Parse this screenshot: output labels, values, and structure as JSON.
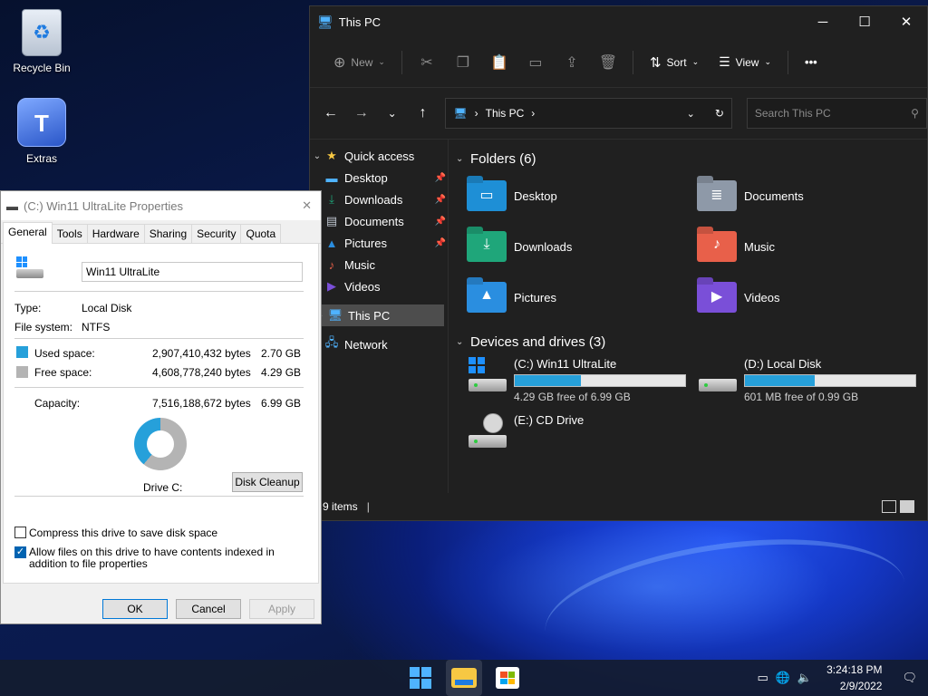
{
  "desktop": {
    "icons": [
      {
        "label": "Recycle Bin",
        "icon": "recycle-bin-icon"
      },
      {
        "label": "Extras",
        "icon": "extras-icon"
      }
    ]
  },
  "explorer": {
    "title": "This PC",
    "toolbar": {
      "new_label": "New",
      "sort_label": "Sort",
      "view_label": "View",
      "more_label": "•••"
    },
    "address": {
      "location": "This PC"
    },
    "search": {
      "placeholder": "Search This PC"
    },
    "nav": {
      "quick_access": "Quick access",
      "items": [
        {
          "label": "Desktop",
          "icon": "desktop-folder-icon"
        },
        {
          "label": "Downloads",
          "icon": "downloads-folder-icon"
        },
        {
          "label": "Documents",
          "icon": "documents-folder-icon"
        },
        {
          "label": "Pictures",
          "icon": "pictures-folder-icon"
        },
        {
          "label": "Music",
          "icon": "music-folder-icon"
        },
        {
          "label": "Videos",
          "icon": "videos-folder-icon"
        }
      ],
      "this_pc": "This PC",
      "network": "Network"
    },
    "folders": {
      "heading": "Folders (6)",
      "items": [
        {
          "label": "Desktop",
          "color": "#1e8fd6"
        },
        {
          "label": "Documents",
          "color": "#8e99a8"
        },
        {
          "label": "Downloads",
          "color": "#1fa67a"
        },
        {
          "label": "Music",
          "color": "#e8604a"
        },
        {
          "label": "Pictures",
          "color": "#2a8ee0"
        },
        {
          "label": "Videos",
          "color": "#7a4fd8"
        }
      ]
    },
    "drives": {
      "heading": "Devices and drives (3)",
      "items": [
        {
          "label": "(C:) Win11 UltraLite",
          "free": "4.29 GB free of 6.99 GB",
          "used_fraction": 0.39
        },
        {
          "label": "(D:) Local Disk",
          "free": "601 MB free of 0.99 GB",
          "used_fraction": 0.41
        },
        {
          "label": "(E:) CD Drive"
        }
      ]
    },
    "status": {
      "items": "9 items"
    }
  },
  "properties": {
    "title": "(C:) Win11 UltraLite Properties",
    "tabs": [
      "General",
      "Tools",
      "Hardware",
      "Sharing",
      "Security",
      "Quota"
    ],
    "name": "Win11 UltraLite",
    "type_label": "Type:",
    "type_value": "Local Disk",
    "fs_label": "File system:",
    "fs_value": "NTFS",
    "used_label": "Used space:",
    "used_bytes": "2,907,410,432 bytes",
    "used_gb": "2.70 GB",
    "free_label": "Free space:",
    "free_bytes": "4,608,778,240 bytes",
    "free_gb": "4.29 GB",
    "cap_label": "Capacity:",
    "cap_bytes": "7,516,188,672 bytes",
    "cap_gb": "6.99 GB",
    "drive_label": "Drive C:",
    "cleanup": "Disk Cleanup",
    "compress": "Compress this drive to save disk space",
    "index": "Allow files on this drive to have contents indexed in addition to file properties",
    "ok": "OK",
    "cancel": "Cancel",
    "apply": "Apply",
    "used_color": "#26a0da",
    "free_color": "#b4b4b4"
  },
  "taskbar": {
    "time": "3:24:18 PM",
    "date": "2/9/2022"
  }
}
